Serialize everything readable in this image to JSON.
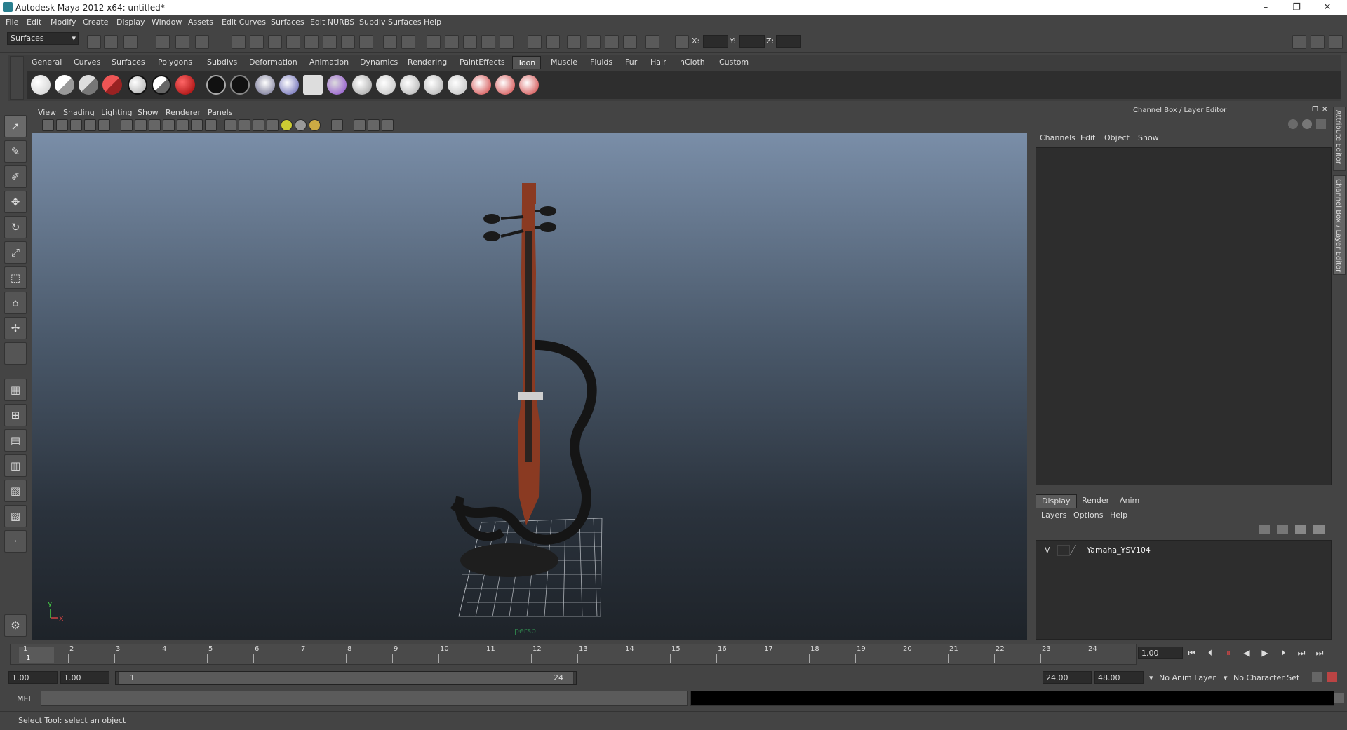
{
  "window": {
    "title": "Autodesk Maya 2012 x64: untitled*",
    "minimize": "–",
    "restore": "❐",
    "close": "✕"
  },
  "menubar": [
    "File",
    "Edit",
    "Modify",
    "Create",
    "Display",
    "Window",
    "Assets",
    "Edit Curves",
    "Surfaces",
    "Edit NURBS",
    "Subdiv Surfaces",
    "Help"
  ],
  "statusline": {
    "menuset": "Surfaces",
    "x_label": "X:",
    "y_label": "Y:",
    "z_label": "Z:"
  },
  "shelf": {
    "tabs": [
      "General",
      "Curves",
      "Surfaces",
      "Polygons",
      "Subdivs",
      "Deformation",
      "Animation",
      "Dynamics",
      "Rendering",
      "PaintEffects",
      "Toon",
      "Muscle",
      "Fluids",
      "Fur",
      "Hair",
      "nCloth",
      "Custom"
    ],
    "active_tab": "Toon"
  },
  "panel": {
    "menus": [
      "View",
      "Shading",
      "Lighting",
      "Show",
      "Renderer",
      "Panels"
    ],
    "camera_label": "persp",
    "axis_y": "y",
    "axis_x": "x"
  },
  "channel_box": {
    "title": "Channel Box / Layer Editor",
    "menus": [
      "Channels",
      "Edit",
      "Object",
      "Show"
    ],
    "side_tab_attr": "Attribute Editor",
    "side_tab_cb": "Channel Box / Layer Editor"
  },
  "layer_editor": {
    "tabs": [
      "Display",
      "Render",
      "Anim"
    ],
    "active_tab": "Display",
    "menus": [
      "Layers",
      "Options",
      "Help"
    ],
    "layers": [
      {
        "visible": "V",
        "name": "Yamaha_YSV104"
      }
    ]
  },
  "time_slider": {
    "ticks": [
      "1",
      "2",
      "3",
      "4",
      "5",
      "6",
      "7",
      "8",
      "9",
      "10",
      "11",
      "12",
      "13",
      "14",
      "15",
      "16",
      "17",
      "18",
      "19",
      "20",
      "21",
      "22",
      "23",
      "24"
    ],
    "current_time": "1.00",
    "current_marker": "1"
  },
  "range_slider": {
    "start_time": "1.00",
    "playback_start": "1.00",
    "range_start_label": "1",
    "range_end_label": "24",
    "playback_end": "24.00",
    "end_time": "48.00",
    "anim_layer": "No Anim Layer",
    "character_set": "No Character Set"
  },
  "command_line": {
    "label": "MEL"
  },
  "help_line": {
    "text": "Select Tool: select an object"
  },
  "colors": {
    "accent": "#5a5a5a",
    "violin_body": "#8a3a22",
    "viewport_top": "#7a8ea8",
    "viewport_bottom": "#1e2329"
  }
}
